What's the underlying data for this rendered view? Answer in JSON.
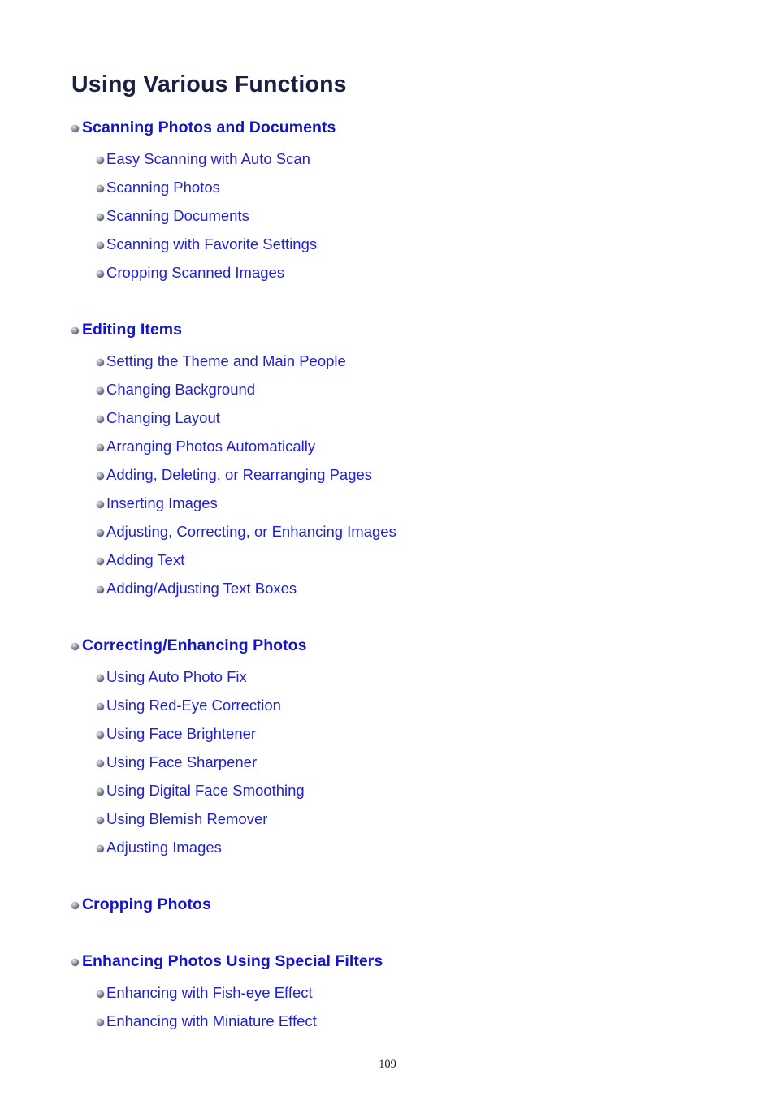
{
  "document": {
    "title": "Using Various Functions",
    "page_number": "109",
    "title_color": "#1b2043",
    "heading_color": "#1414c8",
    "item_color": "#2222cc",
    "background_color": "#ffffff"
  },
  "sections": [
    {
      "heading": "Scanning Photos and Documents",
      "items": [
        {
          "label": "Easy Scanning with Auto Scan"
        },
        {
          "label": "Scanning Photos"
        },
        {
          "label": "Scanning Documents"
        },
        {
          "label": "Scanning with Favorite Settings"
        },
        {
          "label": "Cropping Scanned Images"
        }
      ]
    },
    {
      "heading": "Editing Items",
      "items": [
        {
          "label": "Setting the Theme and Main People"
        },
        {
          "label": "Changing Background"
        },
        {
          "label": "Changing Layout"
        },
        {
          "label": "Arranging Photos Automatically"
        },
        {
          "label": "Adding, Deleting, or Rearranging Pages"
        },
        {
          "label": "Inserting Images"
        },
        {
          "label": "Adjusting, Correcting, or Enhancing Images"
        },
        {
          "label": "Adding Text"
        },
        {
          "label": "Adding/Adjusting Text Boxes"
        }
      ]
    },
    {
      "heading": "Correcting/Enhancing Photos",
      "items": [
        {
          "label": "Using Auto Photo Fix"
        },
        {
          "label": "Using Red-Eye Correction"
        },
        {
          "label": "Using Face Brightener"
        },
        {
          "label": "Using Face Sharpener"
        },
        {
          "label": "Using Digital Face Smoothing"
        },
        {
          "label": "Using Blemish Remover"
        },
        {
          "label": "Adjusting Images"
        }
      ]
    },
    {
      "heading": "Cropping Photos",
      "items": []
    },
    {
      "heading": "Enhancing Photos Using Special Filters",
      "items": [
        {
          "label": "Enhancing with Fish-eye Effect"
        },
        {
          "label": "Enhancing with Miniature Effect"
        }
      ]
    }
  ]
}
